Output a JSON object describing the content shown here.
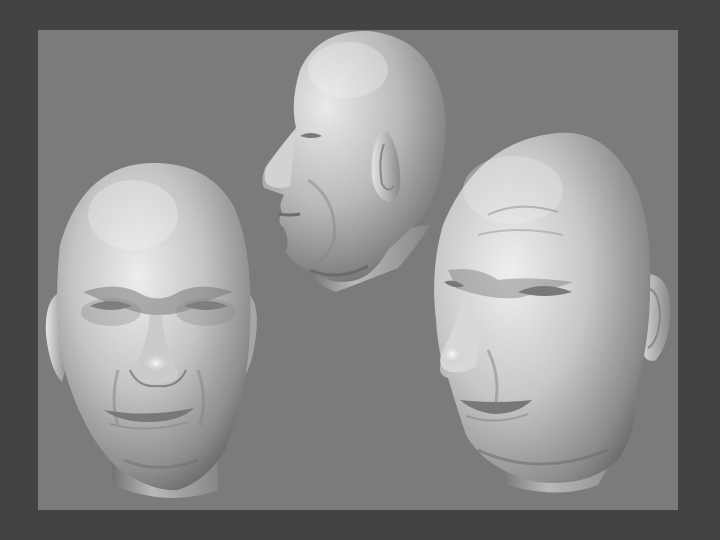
{
  "scene": {
    "background_color": "#434343",
    "viewport_color": "#7b7b7b",
    "surface_color": "#b8b8b8",
    "subject": "3d-head-scan-render",
    "views": [
      {
        "view": "front"
      },
      {
        "view": "profile"
      },
      {
        "view": "three-quarter"
      }
    ]
  }
}
